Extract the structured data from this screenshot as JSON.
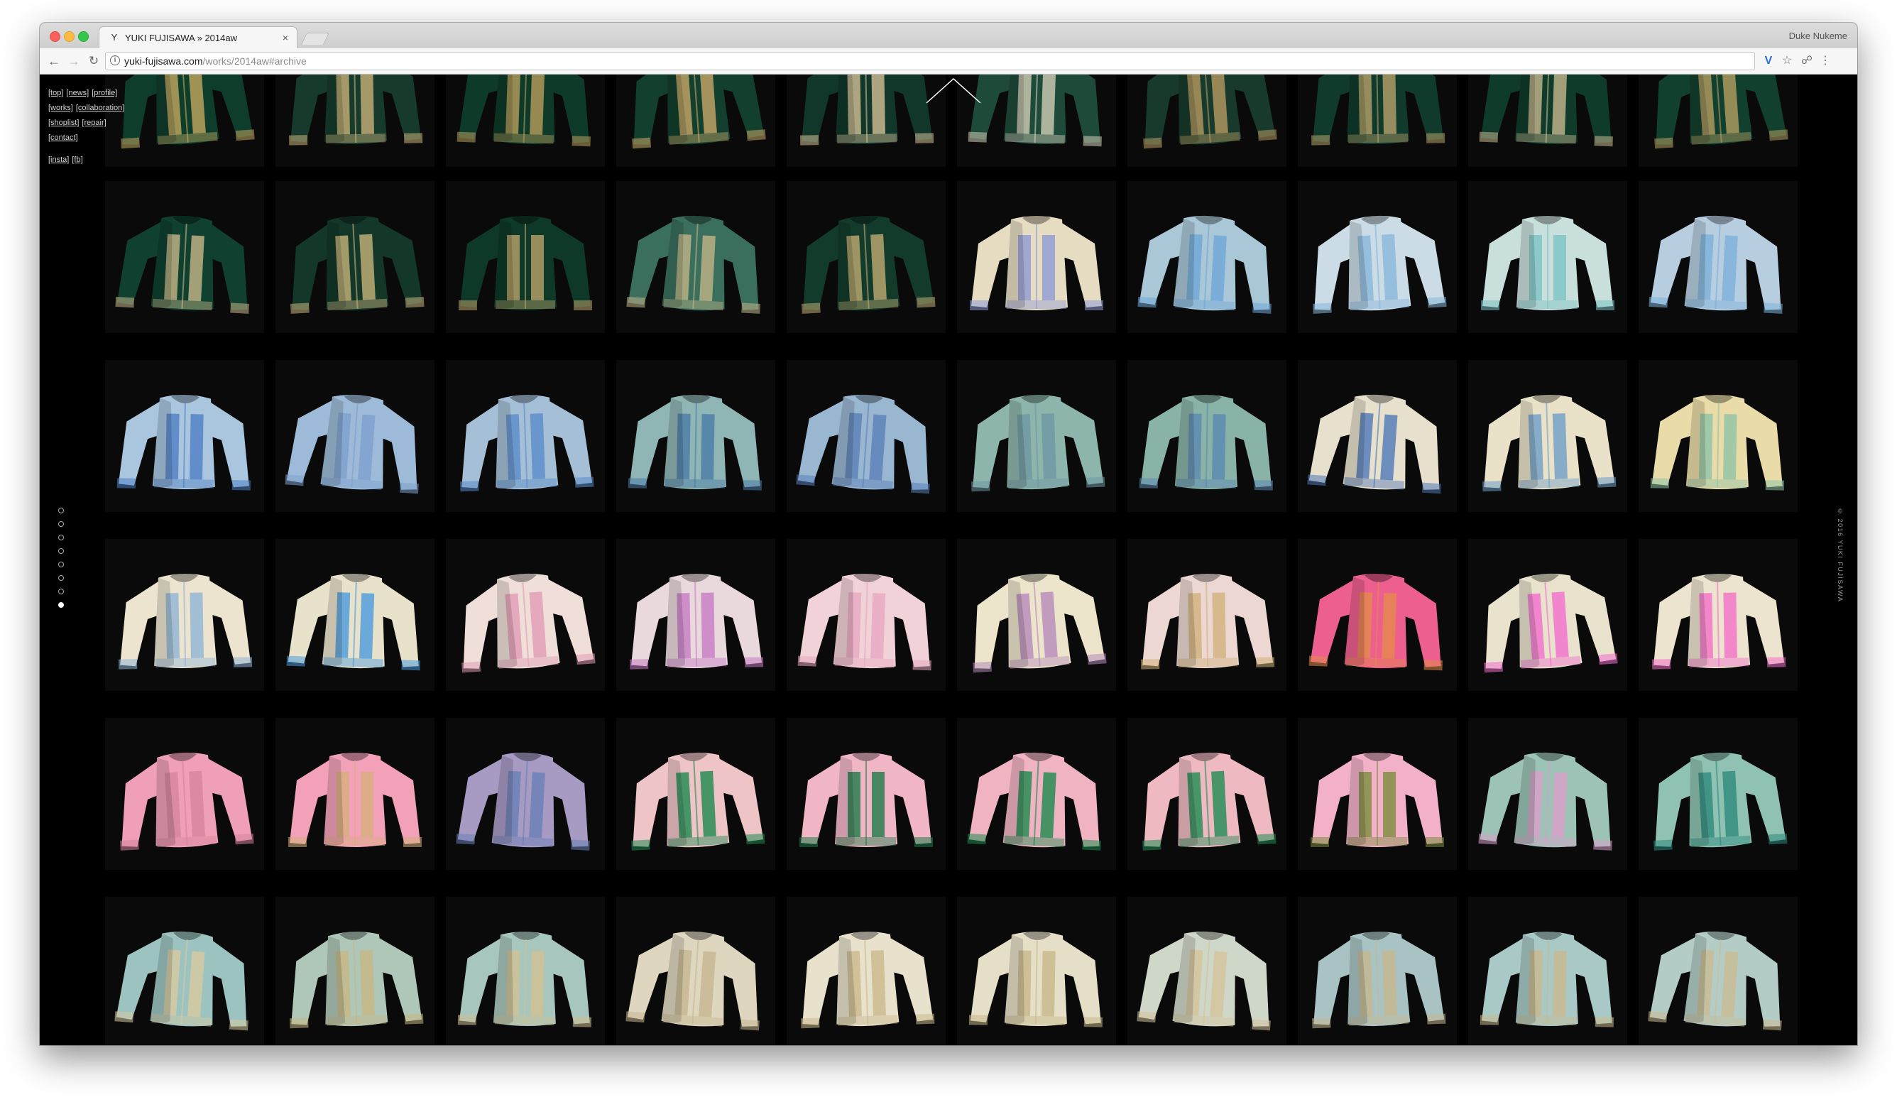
{
  "browser": {
    "tab": {
      "favicon": "Y",
      "title": "YUKI FUJISAWA » 2014aw",
      "close": "×"
    },
    "profile": "Duke Nukeme",
    "url": {
      "host": "yuki-fujisawa.com",
      "path": "/works/2014aw#archive"
    },
    "icons": {
      "back": "back-arrow-icon",
      "forward": "forward-arrow-icon",
      "reload": "reload-icon",
      "info": "info-icon",
      "vpn": "vpn-extension-icon",
      "bookmark": "star-icon",
      "shield": "shield-icon",
      "menu": "kebab-menu-icon"
    }
  },
  "site": {
    "nav": [
      [
        "[top]",
        "[news]",
        "[profile]"
      ],
      [
        "[works]",
        "[collaboration]"
      ],
      [
        "[shoplist]",
        "[repair]"
      ],
      [
        "[contact]"
      ],
      [],
      [
        "[insta]",
        "[fb]"
      ]
    ],
    "copyright": "© 2016 YUKI FUJISAWA",
    "page_dots": {
      "count": 8,
      "active_index": 7
    },
    "archive": {
      "columns": 10,
      "rows": [
        {
          "body": [
            "#0f3d2c",
            "#163b2c",
            "#0e3a2a",
            "#123f2e",
            "#11362a",
            "#1e4a3a",
            "#183a2c",
            "#103a2b",
            "#0f3b2b",
            "#12402e"
          ],
          "accent": [
            "#c2a860",
            "#c9b27a",
            "#b99e5c",
            "#caa969",
            "#d4c196",
            "#d2cdb7",
            "#b89b62",
            "#b6a26a",
            "#c8b88e",
            "#b79e62"
          ]
        },
        {
          "body": [
            "#0f4030",
            "#13382a",
            "#0e3929",
            "#3a6e5d",
            "#123b2c",
            "#e6dcc2",
            "#a9c7d6",
            "#cbdce6",
            "#c9dfdc",
            "#b7cde0"
          ],
          "accent": [
            "#c8b78a",
            "#c9b47c",
            "#bba269",
            "#c2b587",
            "#c1ad72",
            "#8e9bd6",
            "#6ea8d8",
            "#88b6db",
            "#7cc3c6",
            "#7cb2da"
          ]
        },
        {
          "body": [
            "#a9c6de",
            "#9dbbd8",
            "#a5c0d6",
            "#8fb5b4",
            "#9ab7d2",
            "#8db5ab",
            "#89b3a6",
            "#e7e0cc",
            "#e9e1c8",
            "#e9dca8"
          ],
          "accent": [
            "#4f7fc4",
            "#7ea0ce",
            "#5a8bc9",
            "#4a7ca8",
            "#5a7fb8",
            "#6f97a4",
            "#5b88b3",
            "#4f78b8",
            "#6d9fc8",
            "#8fc4a6"
          ]
        },
        {
          "body": [
            "#ece4cf",
            "#e9e2cb",
            "#efdfd8",
            "#ead9dc",
            "#f1d2d9",
            "#ede4cc",
            "#edd7d2",
            "#ed5f8f",
            "#e9e2cd",
            "#ede4cf"
          ],
          "accent": [
            "#8fb4d6",
            "#4a9bdd",
            "#e29bb6",
            "#c77bc5",
            "#e8a8bf",
            "#b58aba",
            "#cfb27a",
            "#e48a4b",
            "#f26fd0",
            "#f26fc8"
          ]
        },
        {
          "body": [
            "#ef9fb7",
            "#f2a1b8",
            "#a79bc4",
            "#efc4c6",
            "#f0b6c6",
            "#f0b3c2",
            "#efb9c2",
            "#f2b1c8",
            "#9cc3b6",
            "#8fc2b2"
          ],
          "accent": [
            "#d4849c",
            "#d6b07c",
            "#6a7fb6",
            "#1d8a4f",
            "#1e7c49",
            "#1b8a4e",
            "#1e8c52",
            "#7c8c3c",
            "#d9a0c9",
            "#2c8a7c"
          ]
        },
        {
          "body": [
            "#9cc3c0",
            "#aec7b8",
            "#a7c6bd",
            "#dfd6c0",
            "#e8e1cc",
            "#e6dfc7",
            "#cfd7c8",
            "#a9c3c4",
            "#a9c9c6",
            "#b3cdc6"
          ],
          "accent": [
            "#d9caa0",
            "#c8b682",
            "#d2c092",
            "#c5b78f",
            "#c9b98c",
            "#c7b78a",
            "#d4c39a",
            "#c7b88f",
            "#cab98c",
            "#cbbc92"
          ]
        }
      ]
    }
  }
}
